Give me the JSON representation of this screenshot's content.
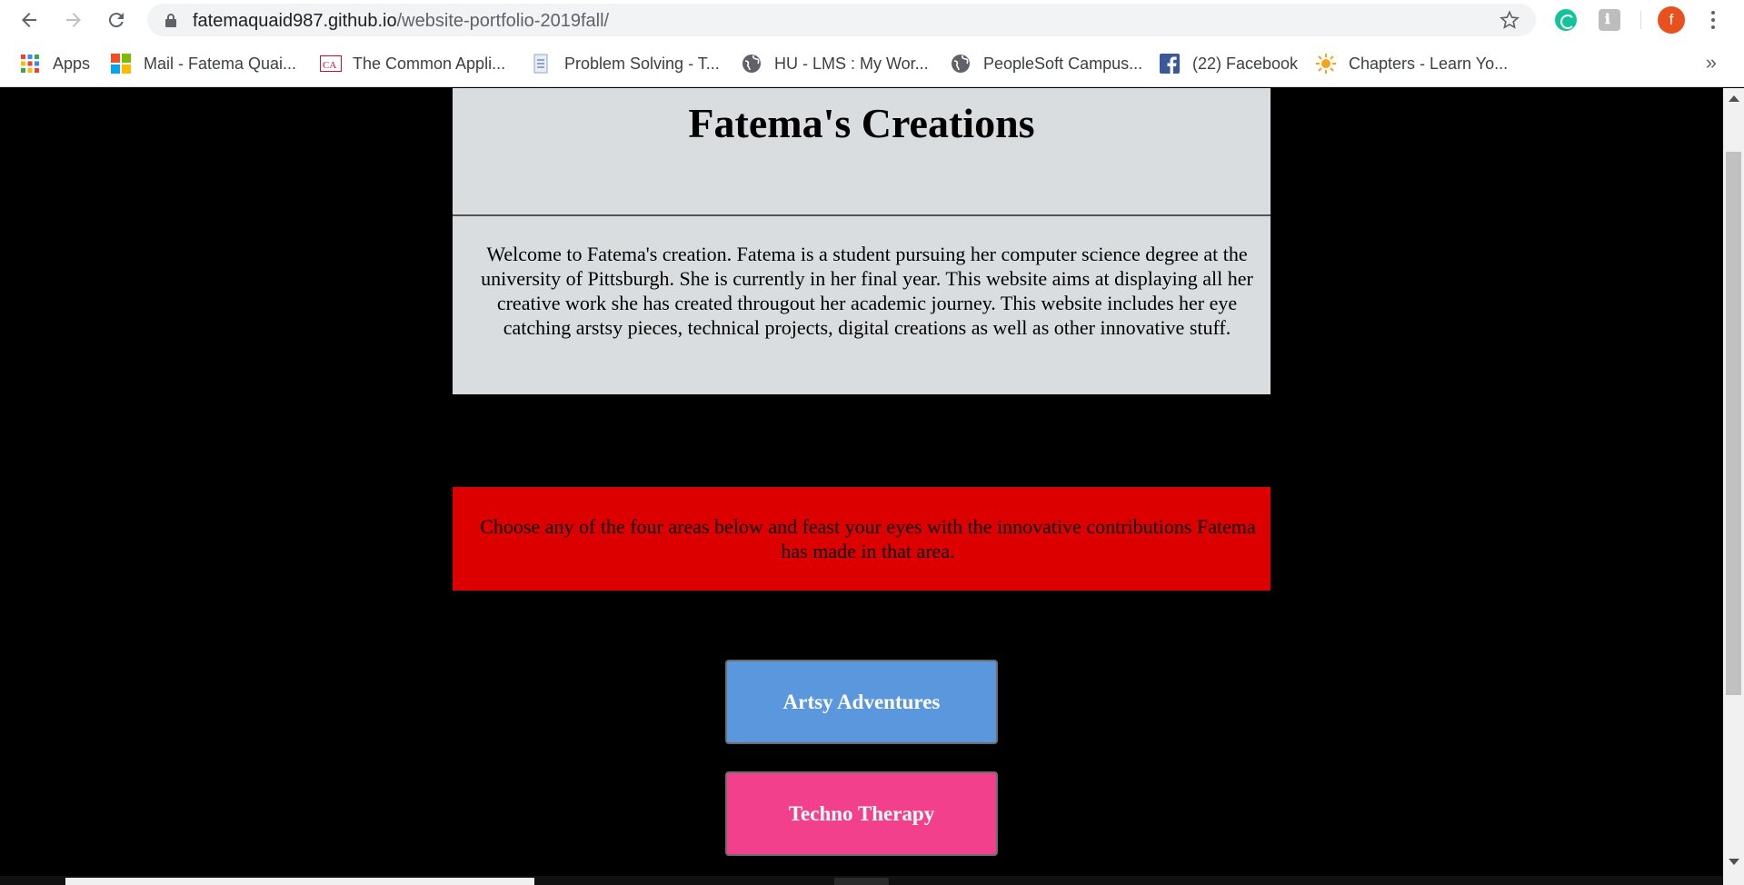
{
  "browser": {
    "url_host": "fatemaquaid987.github.io",
    "url_path": "/website-portfolio-2019fall/",
    "avatar_letter": "f",
    "extension_gray_label": "ℹ"
  },
  "bookmarks": {
    "items": [
      {
        "label": "Apps",
        "icon": "apps-grid-icon"
      },
      {
        "label": "Mail - Fatema Quai...",
        "icon": "microsoft-icon"
      },
      {
        "label": "The Common Appli...",
        "icon": "common-app-icon"
      },
      {
        "label": "Problem Solving - T...",
        "icon": "document-icon"
      },
      {
        "label": "HU - LMS : My Wor...",
        "icon": "globe-icon"
      },
      {
        "label": "PeopleSoft Campus...",
        "icon": "globe-icon"
      },
      {
        "label": "(22) Facebook",
        "icon": "facebook-icon"
      },
      {
        "label": "Chapters - Learn Yo...",
        "icon": "sun-icon"
      }
    ],
    "more": "»"
  },
  "page": {
    "title": "Fatema's Creations",
    "intro": "Welcome to Fatema's creation. Fatema is a student pursuing her computer science degree at the university of Pittsburgh. She is currently in her final year. This website aims at displaying all her creative work she has created througout her academic journey. This website includes her eye catching arstsy pieces, technical projects, digital creations as well as other innovative stuff.",
    "prompt": "Choose any of the four areas below and feast your eyes with the innovative contributions Fatema has made in that area.",
    "buttons": {
      "artsy": "Artsy Adventures",
      "techno": "Techno Therapy"
    }
  },
  "colors": {
    "header_bg": "#d9dde0",
    "prompt_bg": "#dc0000",
    "artsy_bg": "#5b97dc",
    "techno_bg": "#f2408c",
    "page_bg": "#000000"
  }
}
